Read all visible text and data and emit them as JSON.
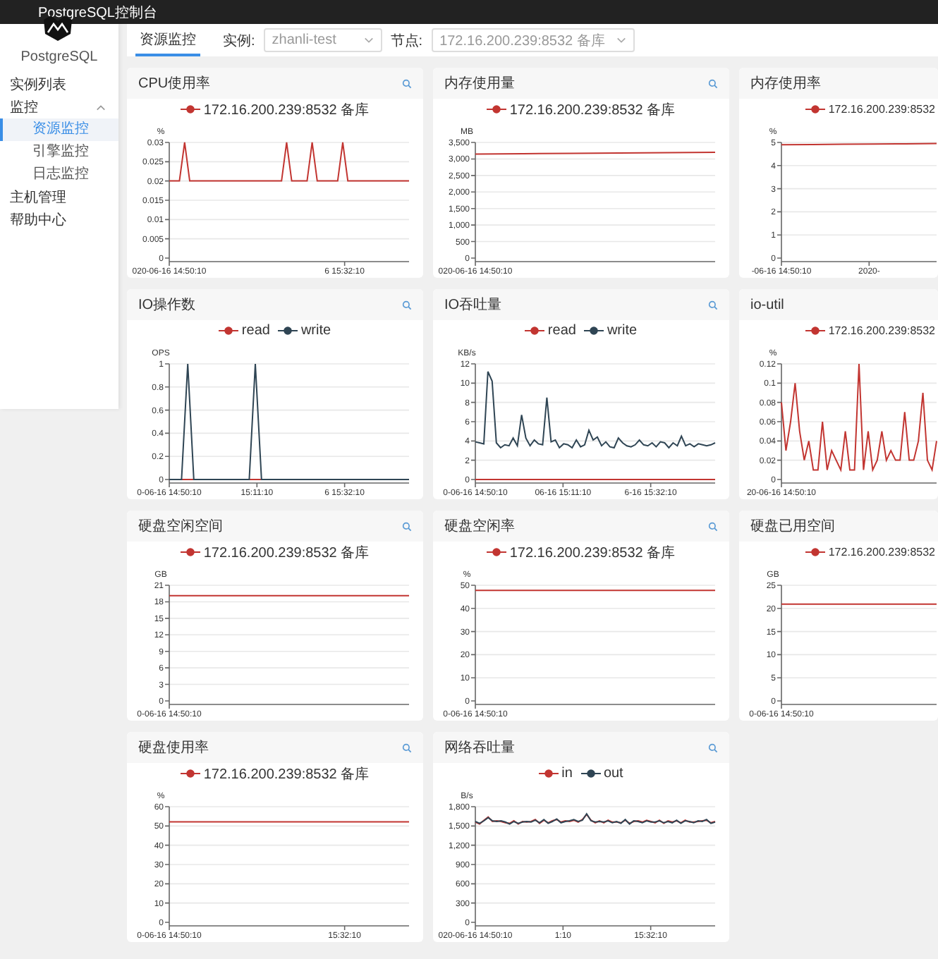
{
  "app_title": "PostgreSQL控制台",
  "sidebar": {
    "brand": "PostgreSQL",
    "items": [
      {
        "label": "实例列表",
        "selected": false
      },
      {
        "label": "监控",
        "selected": false,
        "expanded": true,
        "children": [
          {
            "label": "资源监控",
            "selected": true
          },
          {
            "label": "引擎监控",
            "selected": false
          },
          {
            "label": "日志监控",
            "selected": false
          }
        ]
      },
      {
        "label": "主机管理",
        "selected": false
      },
      {
        "label": "帮助中心",
        "selected": false
      }
    ]
  },
  "header": {
    "tabs": [
      {
        "label": "资源监控",
        "selected": true
      }
    ],
    "filters": [
      {
        "label": "实例:",
        "value": "zhanli-test"
      },
      {
        "label": "节点:",
        "value": "172.16.200.239:8532 备库"
      }
    ]
  },
  "panels": [
    {
      "title": "CPU使用率",
      "search_icon": true,
      "x_labels": {
        "start": "020-06-16 14:50:10",
        "end": "6 15:32:10"
      },
      "chart_data": {
        "type": "line",
        "ylabel": "%",
        "ylim": [
          0,
          0.03
        ],
        "grid": true,
        "yticks": [
          0,
          0.005,
          0.01,
          0.015,
          0.02,
          0.025,
          0.03
        ],
        "series": [
          {
            "name": "172.16.200.239:8532 备库",
            "color": "#c23531",
            "values": [
              0.02,
              0.02,
              0.02,
              0.03,
              0.02,
              0.02,
              0.02,
              0.02,
              0.02,
              0.02,
              0.02,
              0.02,
              0.02,
              0.02,
              0.02,
              0.02,
              0.02,
              0.02,
              0.02,
              0.02,
              0.02,
              0.02,
              0.02,
              0.03,
              0.02,
              0.02,
              0.02,
              0.02,
              0.03,
              0.02,
              0.02,
              0.02,
              0.02,
              0.02,
              0.03,
              0.02,
              0.02,
              0.02,
              0.02,
              0.02,
              0.02,
              0.02,
              0.02,
              0.02,
              0.02,
              0.02,
              0.02,
              0.02
            ]
          }
        ]
      }
    },
    {
      "title": "内存使用量",
      "search_icon": true,
      "x_labels": {
        "start": "020-06-16 14:50:10"
      },
      "chart_data": {
        "type": "line",
        "ylabel": "MB",
        "ylim": [
          0,
          3500
        ],
        "grid": true,
        "yticks": [
          0,
          500,
          {
            "value": 1000,
            "label": "1,000"
          },
          {
            "value": 1500,
            "label": "1,500"
          },
          {
            "value": 2000,
            "label": "2,000"
          },
          {
            "value": 2500,
            "label": "2,500"
          },
          {
            "value": 3000,
            "label": "3,000"
          },
          {
            "value": 3500,
            "label": "3,500"
          }
        ],
        "series": [
          {
            "name": "172.16.200.239:8532 备库",
            "color": "#c23531",
            "values": [
              3150,
              3160,
              3170,
              3180,
              3190,
              3200
            ]
          }
        ]
      }
    },
    {
      "title": "内存使用率",
      "search_icon": false,
      "x_labels": {
        "start": "-06-16 14:50:10",
        "middle": "2020-"
      },
      "chart_data": {
        "type": "line",
        "ylabel": "%",
        "ylim": [
          0,
          5
        ],
        "grid": true,
        "yticks": [
          0,
          1,
          2,
          3,
          4,
          5
        ],
        "series": [
          {
            "name": "172.16.200.239:8532",
            "color": "#c23531",
            "values": [
              4.9,
              4.91,
              4.92,
              4.93,
              4.94,
              4.95
            ]
          }
        ]
      }
    },
    {
      "title": "IO操作数",
      "search_icon": true,
      "x_labels": {
        "start": "0-06-16 14:50:10",
        "middle": "15:11:10",
        "end": "6 15:32:10"
      },
      "chart_data": {
        "type": "line",
        "ylabel": "OPS",
        "ylim": [
          0,
          1
        ],
        "grid": true,
        "yticks": [
          0,
          0.2,
          0.4,
          0.6,
          0.8,
          1
        ],
        "series": [
          {
            "name": "read",
            "color": "#c23531",
            "values": [
              null,
              null,
              0,
              0,
              0,
              null,
              null,
              null,
              null,
              null,
              null,
              null,
              null,
              0,
              0,
              0,
              null,
              null,
              null,
              null,
              null,
              null,
              null,
              null,
              null,
              null,
              null,
              null,
              null,
              null,
              null,
              null,
              null,
              null,
              null,
              null,
              null,
              null,
              null,
              null
            ]
          },
          {
            "name": "write",
            "color": "#2f4554",
            "values": [
              0,
              0,
              0,
              1,
              0,
              0,
              0,
              0,
              0,
              0,
              0,
              0,
              0,
              0,
              1,
              0,
              0,
              0,
              0,
              0,
              0,
              0,
              0,
              0,
              0,
              0,
              0,
              0,
              0,
              0,
              0,
              0,
              0,
              0,
              0,
              0,
              0,
              0,
              0,
              0
            ]
          }
        ]
      }
    },
    {
      "title": "IO吞吐量",
      "search_icon": true,
      "x_labels": {
        "start": "0-06-16 14:50:10",
        "middle": "06-16 15:11:10",
        "end": "6-16 15:32:10"
      },
      "chart_data": {
        "type": "line",
        "ylabel": "KB/s",
        "ylim": [
          0,
          12
        ],
        "grid": true,
        "yticks": [
          0,
          2,
          4,
          6,
          8,
          10,
          12
        ],
        "series": [
          {
            "name": "read",
            "color": "#c23531",
            "values": [
              0,
              0,
              0,
              0,
              0,
              0,
              0,
              0,
              0,
              0,
              0,
              0,
              0,
              0,
              0,
              0,
              0,
              0,
              0,
              0,
              0,
              0,
              0,
              0,
              0,
              0,
              0,
              0,
              0,
              0,
              0,
              0,
              0,
              0,
              0,
              0,
              0,
              0,
              0,
              0,
              0,
              0,
              0,
              0,
              0,
              0,
              0,
              0,
              0,
              0,
              0,
              0,
              0,
              0,
              0,
              0,
              0,
              0
            ]
          },
          {
            "name": "write",
            "color": "#2f4554",
            "values": [
              3.9,
              3.8,
              3.7,
              11.2,
              10.2,
              3.8,
              3.3,
              3.6,
              3.5,
              4.3,
              3.5,
              6.7,
              4.3,
              3.5,
              4.1,
              3.7,
              3.6,
              8.5,
              3.9,
              4.1,
              3.3,
              3.7,
              3.6,
              3.3,
              4.1,
              3.4,
              3.6,
              5.1,
              4.1,
              4.4,
              3.5,
              3.9,
              3.4,
              3.3,
              4.3,
              3.8,
              3.5,
              3.4,
              3.6,
              4.1,
              3.6,
              3.5,
              3.8,
              3.4,
              3.9,
              3.8,
              3.3,
              3.8,
              3.5,
              4.5,
              3.5,
              3.7,
              3.4,
              3.7,
              3.6,
              3.5,
              3.6,
              3.8
            ]
          }
        ]
      }
    },
    {
      "title": "io-util",
      "search_icon": false,
      "x_labels": {
        "start": "20-06-16 14:50:10"
      },
      "chart_data": {
        "type": "line",
        "ylabel": "%",
        "ylim": [
          0,
          0.12
        ],
        "grid": true,
        "yticks": [
          0,
          0.02,
          0.04,
          0.06,
          0.08,
          0.1,
          0.12
        ],
        "series": [
          {
            "name": "172.16.200.239:8532",
            "color": "#c23531",
            "values": [
              0.08,
              0.03,
              0.06,
              0.1,
              0.05,
              0.02,
              0.04,
              0.01,
              0.01,
              0.06,
              0.01,
              0.03,
              0.02,
              0.01,
              0.05,
              0.01,
              0.01,
              0.12,
              0.01,
              0.05,
              0.01,
              0.02,
              0.05,
              0.02,
              0.03,
              0.02,
              0.02,
              0.07,
              0.02,
              0.02,
              0.04,
              0.09,
              0.02,
              0.01,
              0.04
            ]
          }
        ]
      }
    },
    {
      "title": "硬盘空闲空间",
      "search_icon": true,
      "x_labels": {
        "start": "0-06-16 14:50:10"
      },
      "chart_data": {
        "type": "line",
        "ylabel": "GB",
        "ylim": [
          0,
          21
        ],
        "grid": true,
        "yticks": [
          0,
          3,
          6,
          9,
          12,
          15,
          18,
          21
        ],
        "series": [
          {
            "name": "172.16.200.239:8532 备库",
            "color": "#c23531",
            "values": [
              19.1,
              19.1,
              19.1,
              19.1,
              19.1,
              19.1
            ]
          }
        ]
      }
    },
    {
      "title": "硬盘空闲率",
      "search_icon": true,
      "x_labels": {
        "start": "0-06-16 14:50:10"
      },
      "chart_data": {
        "type": "line",
        "ylabel": "%",
        "ylim": [
          0,
          50
        ],
        "grid": true,
        "yticks": [
          0,
          10,
          20,
          30,
          40,
          50
        ],
        "series": [
          {
            "name": "172.16.200.239:8532 备库",
            "color": "#c23531",
            "values": [
              47.8,
              47.8,
              47.8,
              47.8,
              47.8,
              47.8
            ]
          }
        ]
      }
    },
    {
      "title": "硬盘已用空间",
      "search_icon": false,
      "x_labels": {
        "start": "0-06-16 14:50:10"
      },
      "chart_data": {
        "type": "line",
        "ylabel": "GB",
        "ylim": [
          0,
          25
        ],
        "grid": true,
        "yticks": [
          0,
          5,
          10,
          15,
          20,
          25
        ],
        "series": [
          {
            "name": "172.16.200.239:8532",
            "color": "#c23531",
            "values": [
              20.9,
              20.9,
              20.9,
              20.9,
              20.9
            ]
          }
        ]
      }
    },
    {
      "title": "硬盘使用率",
      "search_icon": true,
      "x_labels": {
        "start": "0-06-16 14:50:10",
        "end": "15:32:10"
      },
      "chart_data": {
        "type": "line",
        "ylabel": "%",
        "ylim": [
          0,
          60
        ],
        "grid": true,
        "yticks": [
          0,
          10,
          20,
          30,
          40,
          50,
          60
        ],
        "series": [
          {
            "name": "172.16.200.239:8532 备库",
            "color": "#c23531",
            "values": [
              52.2,
              52.2,
              52.2,
              52.2,
              52.2,
              52.2
            ]
          }
        ]
      }
    },
    {
      "title": "网络吞吐量",
      "search_icon": true,
      "x_labels": {
        "start": "020-06-16 14:50:10",
        "middle": "1:10",
        "end": "15:32:10"
      },
      "chart_data": {
        "type": "line",
        "ylabel": "B/s",
        "ylim": [
          0,
          1800
        ],
        "grid": true,
        "yticks": [
          0,
          300,
          600,
          900,
          {
            "value": 1200,
            "label": "1,200"
          },
          {
            "value": 1500,
            "label": "1,500"
          },
          {
            "value": 1800,
            "label": "1,800"
          }
        ],
        "series": [
          {
            "name": "in",
            "color": "#c23531",
            "values": [
              1560,
              1530,
              1590,
              1640,
              1570,
              1580,
              1570,
              1550,
              1540,
              1580,
              1530,
              1570,
              1560,
              1570,
              1600,
              1540,
              1590,
              1550,
              1580,
              1600,
              1560,
              1580,
              1570,
              1590,
              1560,
              1600,
              1680,
              1590,
              1550,
              1580,
              1550,
              1590,
              1560,
              1560,
              1550,
              1590,
              1540,
              1570,
              1580,
              1560,
              1590,
              1570,
              1550,
              1590,
              1540,
              1580,
              1560,
              1580,
              1550,
              1590,
              1560,
              1560,
              1570,
              1580,
              1590,
              1550,
              1570
            ]
          },
          {
            "name": "out",
            "color": "#2f4554",
            "values": [
              1570,
              1540,
              1580,
              1630,
              1580,
              1570,
              1580,
              1560,
              1530,
              1570,
              1540,
              1560,
              1570,
              1560,
              1590,
              1550,
              1600,
              1540,
              1570,
              1610,
              1550,
              1570,
              1580,
              1600,
              1570,
              1590,
              1690,
              1580,
              1560,
              1570,
              1560,
              1580,
              1550,
              1570,
              1540,
              1600,
              1530,
              1580,
              1570,
              1550,
              1580,
              1560,
              1560,
              1580,
              1550,
              1570,
              1550,
              1590,
              1540,
              1580,
              1570,
              1550,
              1580,
              1570,
              1600,
              1540,
              1560
            ]
          }
        ]
      }
    }
  ]
}
